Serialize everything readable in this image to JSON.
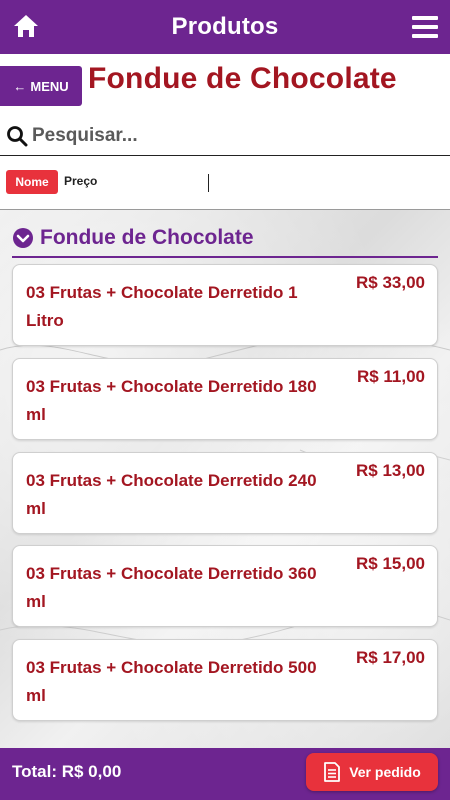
{
  "topbar": {
    "title": "Produtos"
  },
  "header": {
    "back_label": "MENU",
    "page_title": "Fondue de Chocolate"
  },
  "search": {
    "placeholder": "Pesquisar..."
  },
  "sort": {
    "active": "Nome",
    "other": "Preço"
  },
  "category": {
    "title": "Fondue de Chocolate"
  },
  "products": [
    {
      "name": "03 Frutas + Chocolate Derretido 1 Litro",
      "price": "R$ 33,00"
    },
    {
      "name": "03 Frutas + Chocolate Derretido 180 ml",
      "price": "R$ 11,00"
    },
    {
      "name": "03 Frutas + Chocolate Derretido 240 ml",
      "price": "R$ 13,00"
    },
    {
      "name": "03 Frutas + Chocolate Derretido 360 ml",
      "price": "R$ 15,00"
    },
    {
      "name": "03 Frutas + Chocolate Derretido 500 ml",
      "price": "R$ 17,00"
    }
  ],
  "footer": {
    "total": "Total: R$ 0,00",
    "order_button": "Ver pedido"
  },
  "icons": {
    "home": "home-icon",
    "menu": "hamburger-menu-icon",
    "back": "arrow-left-icon",
    "search": "search-icon",
    "category": "chevron-down-circle-icon",
    "order": "document-icon"
  },
  "colors": {
    "brand_purple": "#6d2590",
    "accent_red": "#e8323c",
    "text_red": "#a31621"
  }
}
